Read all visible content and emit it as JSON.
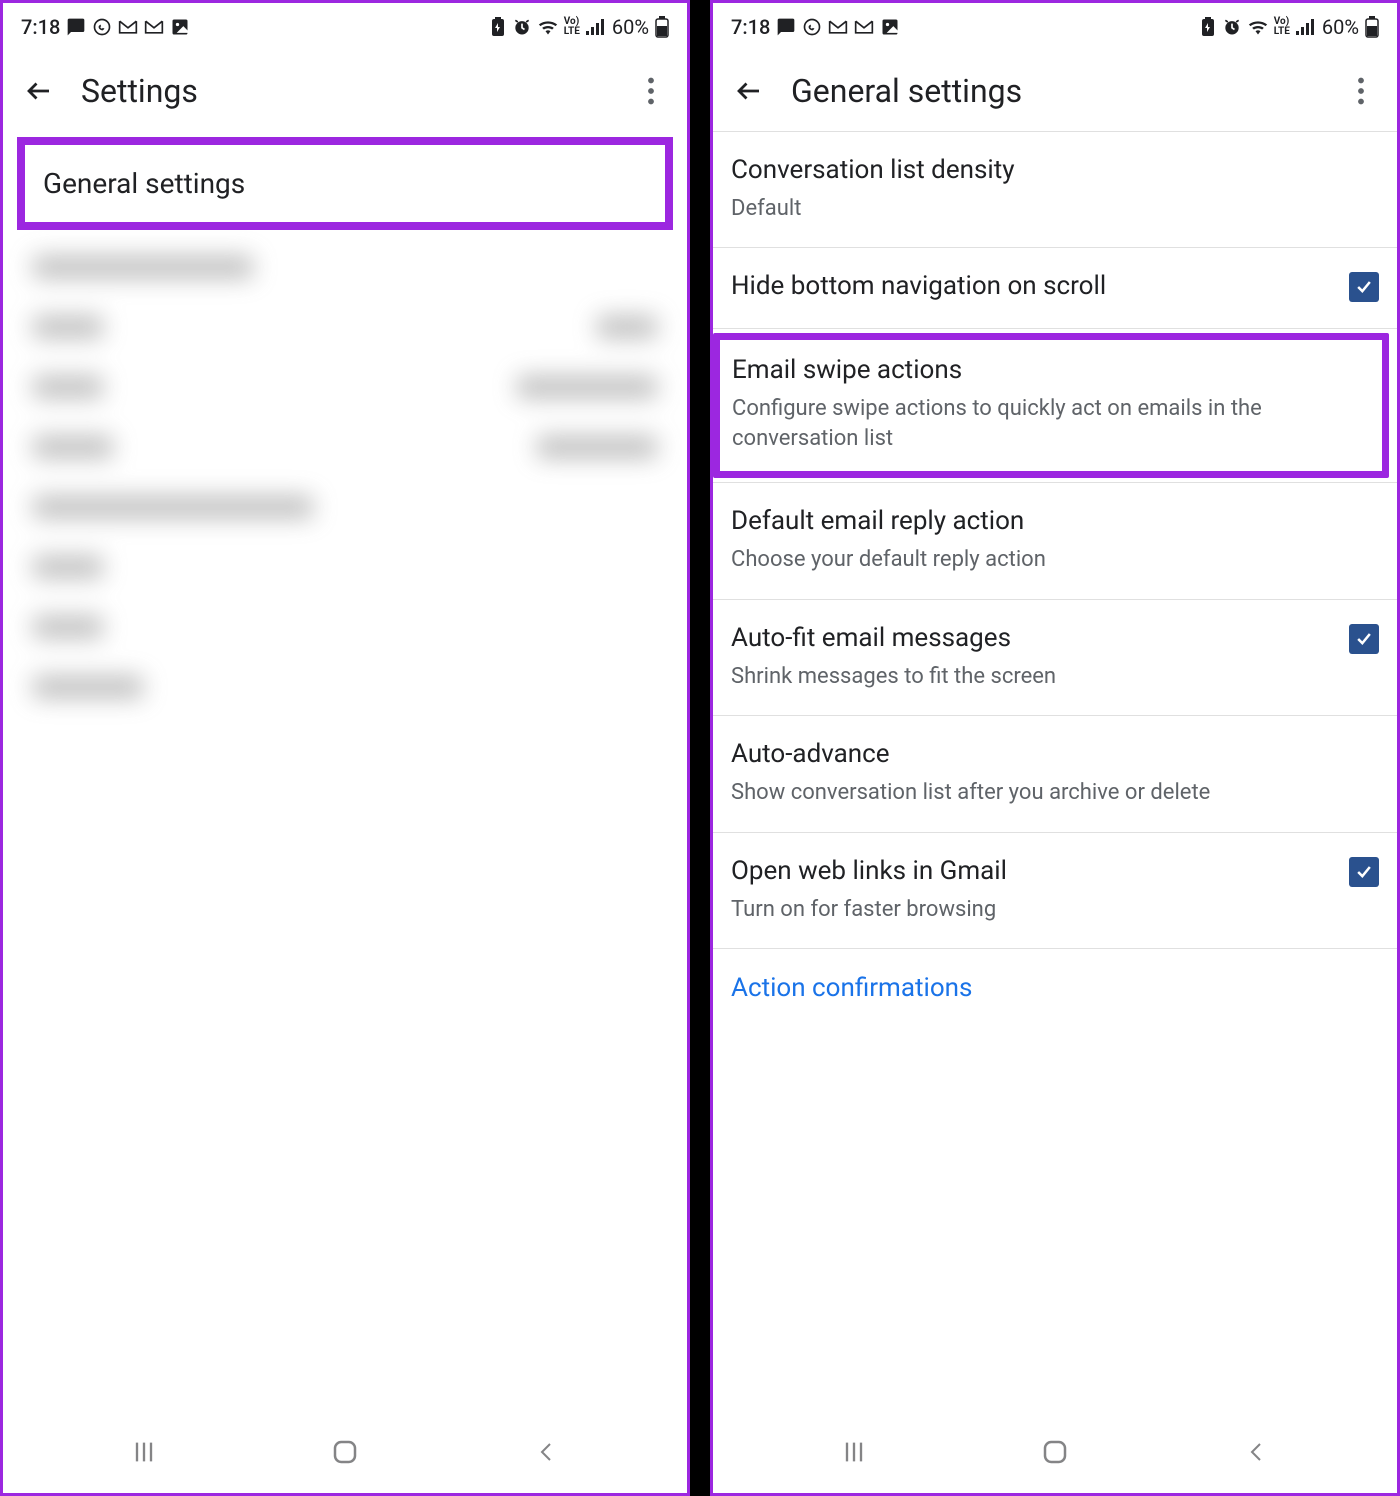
{
  "status": {
    "time": "7:18",
    "battery": "60%"
  },
  "left": {
    "title": "Settings",
    "general_settings": "General settings"
  },
  "right": {
    "title": "General settings",
    "items": [
      {
        "title": "Conversation list density",
        "sub": "Default",
        "checkbox": false
      },
      {
        "title": "Hide bottom navigation on scroll",
        "sub": "",
        "checkbox": true
      },
      {
        "title": "Email swipe actions",
        "sub": "Configure swipe actions to quickly act on emails in the conversation list",
        "checkbox": false,
        "highlight": true
      },
      {
        "title": "Default email reply action",
        "sub": "Choose your default reply action",
        "checkbox": false
      },
      {
        "title": "Auto-fit email messages",
        "sub": "Shrink messages to fit the screen",
        "checkbox": true
      },
      {
        "title": "Auto-advance",
        "sub": "Show conversation list after you archive or delete",
        "checkbox": false
      },
      {
        "title": "Open web links in Gmail",
        "sub": "Turn on for faster browsing",
        "checkbox": true
      }
    ],
    "section_heading": "Action confirmations"
  }
}
